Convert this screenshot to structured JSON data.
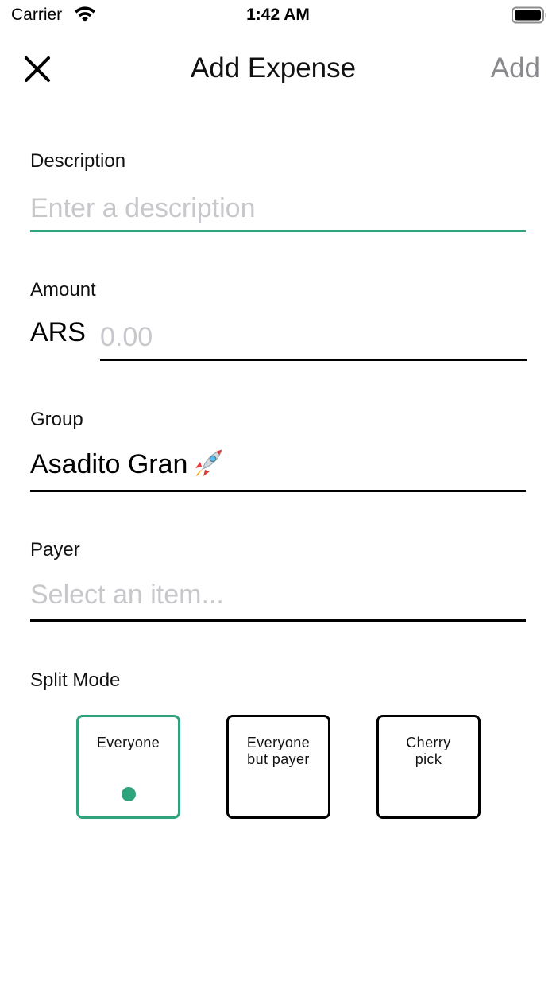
{
  "status_bar": {
    "carrier": "Carrier",
    "time": "1:42 AM",
    "wifi_icon": "wifi-icon",
    "battery_icon": "battery-icon"
  },
  "nav": {
    "close_icon": "close-icon",
    "title": "Add Expense",
    "add_label": "Add"
  },
  "form": {
    "description": {
      "label": "Description",
      "value": "",
      "placeholder": "Enter a description"
    },
    "amount": {
      "label": "Amount",
      "currency": "ARS",
      "value": "",
      "placeholder": "0.00"
    },
    "group": {
      "label": "Group",
      "value": "Asadito Gran",
      "emoji_icon": "rocket-icon"
    },
    "payer": {
      "label": "Payer",
      "placeholder": "Select an item..."
    },
    "split_mode": {
      "label": "Split Mode",
      "options": [
        {
          "line1": "Everyone",
          "line2": "",
          "selected": true
        },
        {
          "line1": "Everyone",
          "line2": "but payer",
          "selected": false
        },
        {
          "line1": "Cherry",
          "line2": "pick",
          "selected": false
        }
      ]
    }
  },
  "colors": {
    "accent": "#2fa37c",
    "placeholder": "#c7c7cc",
    "disabled_action": "#8a8a8e"
  }
}
